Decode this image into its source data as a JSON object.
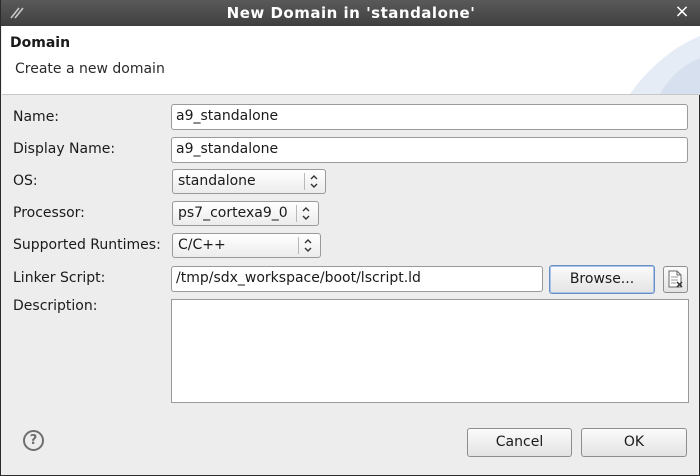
{
  "window": {
    "title": "New Domain in 'standalone'"
  },
  "banner": {
    "title": "Domain",
    "subtitle": "Create a new domain"
  },
  "form": {
    "name": {
      "label": "Name:",
      "value": "a9_standalone"
    },
    "display_name": {
      "label": "Display Name:",
      "value": "a9_standalone"
    },
    "os": {
      "label": "OS:",
      "value": "standalone"
    },
    "processor": {
      "label": "Processor:",
      "value": "ps7_cortexa9_0"
    },
    "runtimes": {
      "label": "Supported Runtimes:",
      "value": "C/C++"
    },
    "linker": {
      "label": "Linker Script:",
      "value": "/tmp/sdx_workspace/boot/lscript.ld",
      "browse_label": "Browse..."
    },
    "description": {
      "label": "Description:",
      "value": ""
    }
  },
  "footer": {
    "help_glyph": "?",
    "cancel_label": "Cancel",
    "ok_label": "OK"
  }
}
